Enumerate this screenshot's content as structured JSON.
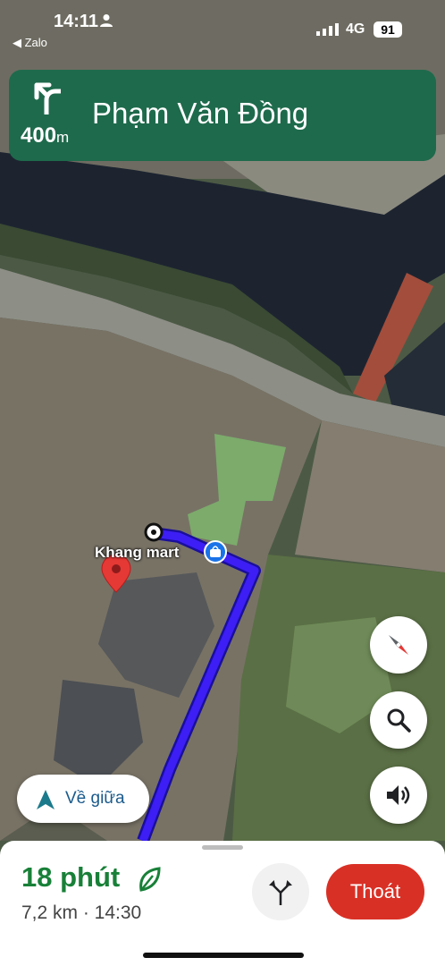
{
  "status_bar": {
    "time": "14:11",
    "back_app": "◀ Zalo",
    "network": "4G",
    "battery": "91"
  },
  "navigation": {
    "turn_icon": "turn-left-arrow-icon",
    "distance_value": "400",
    "distance_unit": "m",
    "street": "Phạm Văn Đồng"
  },
  "map": {
    "poi_label": "Khang mart",
    "route_color": "#3d1ef5",
    "compass_icon": "compass-icon",
    "search_icon": "search-icon",
    "sound_icon": "volume-icon"
  },
  "recenter": {
    "label": "Về giữa"
  },
  "trip": {
    "eta_duration": "18 phút",
    "details": "7,2 km · 14:30",
    "eco_icon": "leaf-icon",
    "routes_icon": "alternate-routes-icon",
    "exit_label": "Thoát",
    "accent_green": "#188038",
    "exit_red": "#d93025"
  }
}
